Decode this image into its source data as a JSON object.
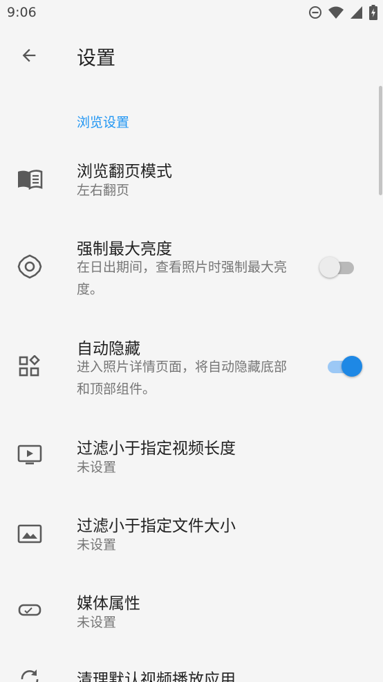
{
  "status_bar": {
    "time": "9:06",
    "icons": [
      "do-not-disturb-icon",
      "wifi-icon",
      "cell-signal-icon",
      "battery-charging-icon"
    ]
  },
  "toolbar": {
    "back_icon": "arrow-back-icon",
    "title": "设置"
  },
  "colors": {
    "accent": "#2196f3",
    "switch_on_thumb": "#1e88e5",
    "switch_on_track": "#9cc8f5",
    "background": "#f5f5f5"
  },
  "section": {
    "title": "浏览设置"
  },
  "items": [
    {
      "icon": "book-open-icon",
      "title": "浏览翻页模式",
      "summary": "左右翻页"
    },
    {
      "icon": "brightness-icon",
      "title": "强制最大亮度",
      "summary": "在日出期间，查看照片时强制最大亮度。",
      "switch": "off"
    },
    {
      "icon": "widgets-icon",
      "title": "自动隐藏",
      "summary": "进入照片详情页面，将自动隐藏底部和顶部组件。",
      "switch": "on"
    },
    {
      "icon": "video-screen-icon",
      "title": "过滤小于指定视频长度",
      "summary": "未设置"
    },
    {
      "icon": "image-icon",
      "title": "过滤小于指定文件大小",
      "summary": "未设置"
    },
    {
      "icon": "tag-icon",
      "title": "媒体属性",
      "summary": "未设置"
    },
    {
      "icon": "sync-icon",
      "title": "清理默认视频播放应用"
    }
  ]
}
